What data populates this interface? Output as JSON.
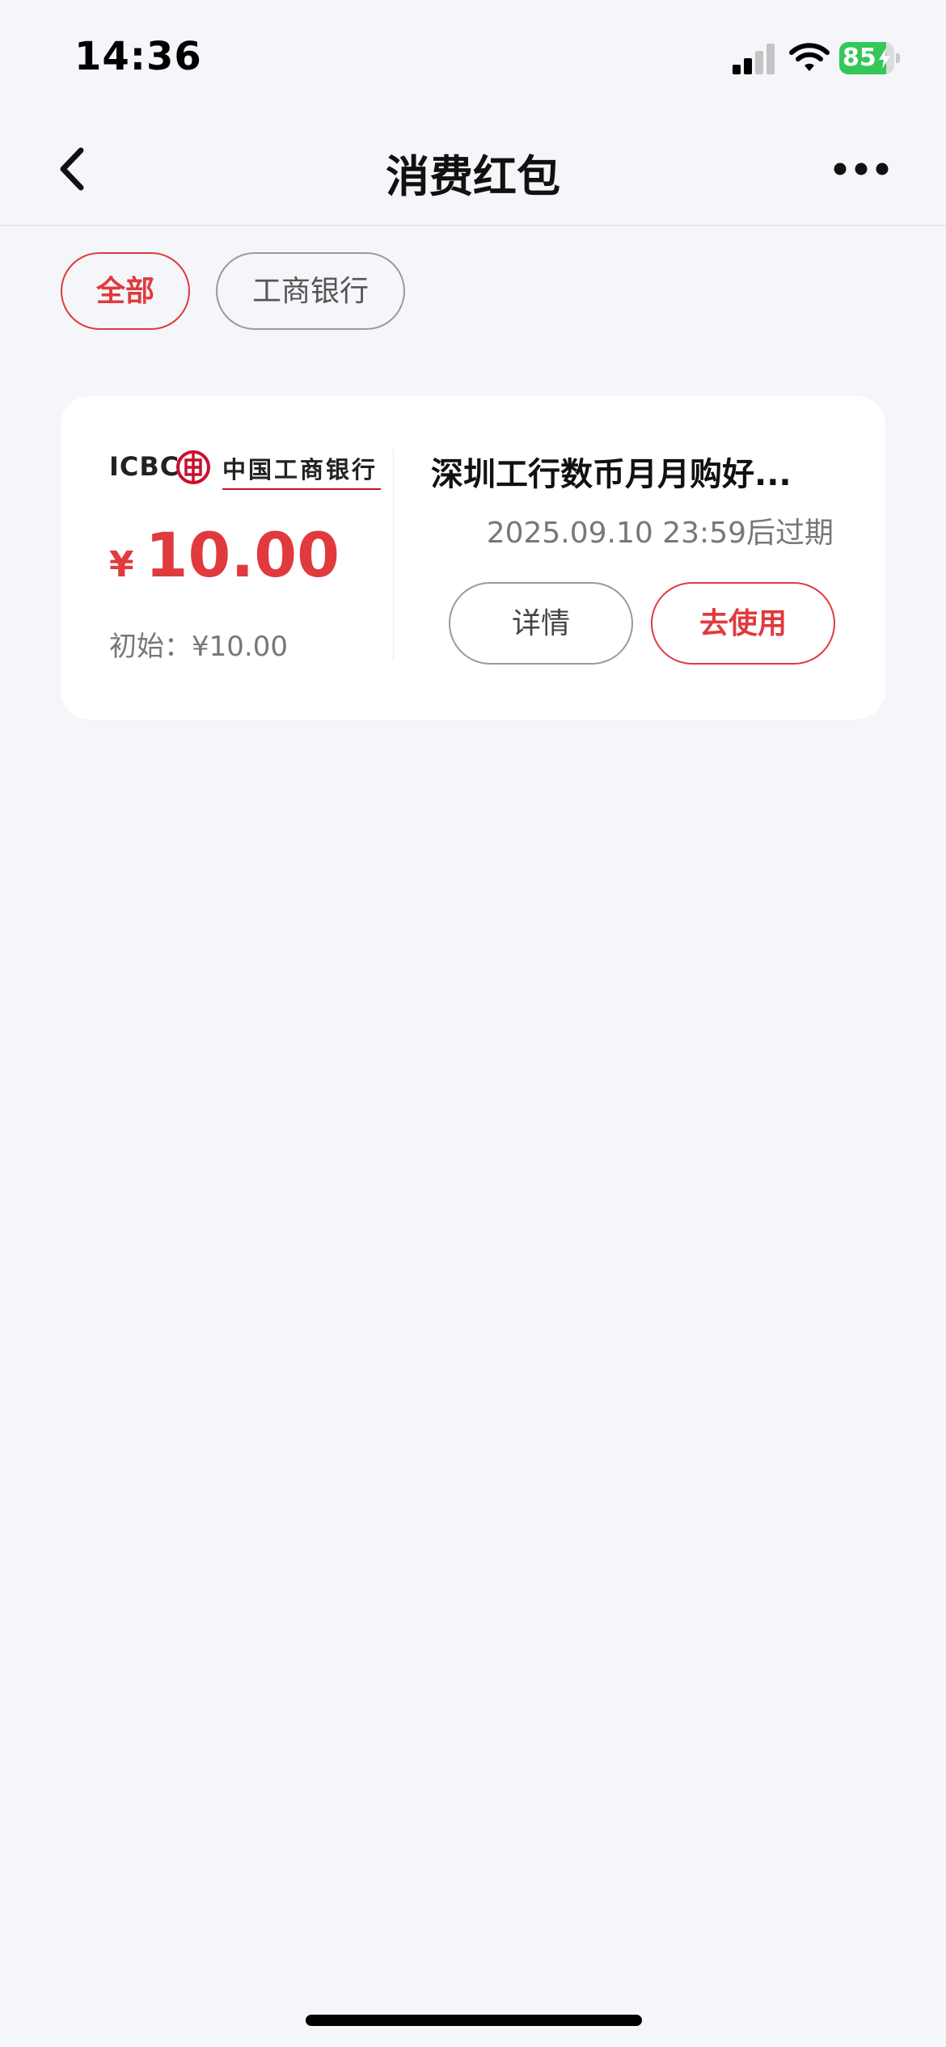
{
  "status_bar": {
    "time": "14:36",
    "battery_level": 85,
    "battery_text": "85",
    "icons": [
      "signal-icon",
      "wifi-icon",
      "battery-icon",
      "charging-bolt-icon"
    ]
  },
  "nav": {
    "title": "消费红包",
    "back_icon": "chevron-left-icon",
    "more_icon": "more-horizontal-icon"
  },
  "filters": {
    "all_label": "全部",
    "bank_label": "工商银行",
    "selected": "全部"
  },
  "coupon": {
    "logo_en": "ICBC",
    "logo_cn": "中国工商银行",
    "currency": "¥",
    "amount": "10.00",
    "initial_label": "初始：¥10.00",
    "title": "深圳工行数币月月购好...",
    "expiry": "2025.09.10 23:59后过期",
    "detail_label": "详情",
    "use_label": "去使用"
  },
  "colors": {
    "accent": "#e03a3e",
    "background": "#f5f6f9",
    "card": "#ffffff",
    "battery": "#34c759"
  }
}
